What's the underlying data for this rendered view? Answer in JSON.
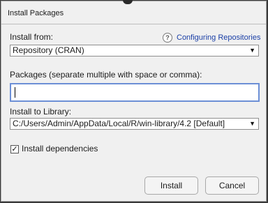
{
  "window": {
    "title": "Install Packages"
  },
  "install_from": {
    "label": "Install from:",
    "value": "Repository (CRAN)",
    "arrow": "▼"
  },
  "help": {
    "icon": "?",
    "link_label": "Configuring Repositories"
  },
  "packages": {
    "label": "Packages (separate multiple with space or comma):",
    "value": ""
  },
  "library": {
    "label": "Install to Library:",
    "value": "C:/Users/Admin/AppData/Local/R/win-library/4.2 [Default]",
    "arrow": "▼"
  },
  "dependencies": {
    "label": "Install dependencies",
    "checked": true,
    "check_mark": "✓"
  },
  "buttons": {
    "install": "Install",
    "cancel": "Cancel"
  },
  "colors": {
    "focus_border": "#6c8fd6",
    "link": "#1a3fa6"
  }
}
